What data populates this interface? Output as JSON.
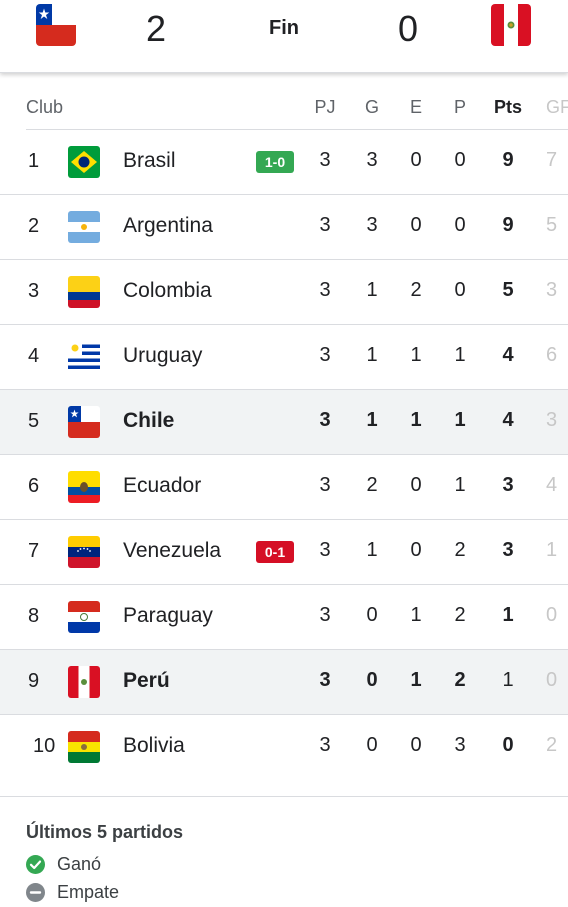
{
  "match": {
    "home_score": "2",
    "status": "Fin",
    "away_score": "0"
  },
  "table": {
    "headers": {
      "club": "Club",
      "pj": "PJ",
      "g": "G",
      "e": "E",
      "p": "P",
      "pts": "Pts",
      "gf": "GF"
    },
    "rows": [
      {
        "rank": "1",
        "team": "Brasil",
        "badge": "1-0",
        "pj": "3",
        "g": "3",
        "e": "0",
        "p": "0",
        "pts": "9",
        "gf": "7"
      },
      {
        "rank": "2",
        "team": "Argentina",
        "pj": "3",
        "g": "3",
        "e": "0",
        "p": "0",
        "pts": "9",
        "gf": "5"
      },
      {
        "rank": "3",
        "team": "Colombia",
        "pj": "3",
        "g": "1",
        "e": "2",
        "p": "0",
        "pts": "5",
        "gf": "3"
      },
      {
        "rank": "4",
        "team": "Uruguay",
        "pj": "3",
        "g": "1",
        "e": "1",
        "p": "1",
        "pts": "4",
        "gf": "6"
      },
      {
        "rank": "5",
        "team": "Chile",
        "pj": "3",
        "g": "1",
        "e": "1",
        "p": "1",
        "pts": "4",
        "gf": "3"
      },
      {
        "rank": "6",
        "team": "Ecuador",
        "pj": "3",
        "g": "2",
        "e": "0",
        "p": "1",
        "pts": "3",
        "gf": "4"
      },
      {
        "rank": "7",
        "team": "Venezuela",
        "badge": "0-1",
        "pj": "3",
        "g": "1",
        "e": "0",
        "p": "2",
        "pts": "3",
        "gf": "1"
      },
      {
        "rank": "8",
        "team": "Paraguay",
        "pj": "3",
        "g": "0",
        "e": "1",
        "p": "2",
        "pts": "1",
        "gf": "0"
      },
      {
        "rank": "9",
        "team": "Perú",
        "pj": "3",
        "g": "0",
        "e": "1",
        "p": "2",
        "pts": "1",
        "gf": "0"
      },
      {
        "rank": "10",
        "team": "Bolivia",
        "pj": "3",
        "g": "0",
        "e": "0",
        "p": "3",
        "pts": "0",
        "gf": "2"
      }
    ]
  },
  "legend": {
    "title": "Últimos 5 partidos",
    "won": "Ganó",
    "draw": "Empate"
  },
  "colors": {
    "win_badge": "#34a853",
    "loss_badge": "#d50f25",
    "highlight_row": "#f1f3f4"
  }
}
